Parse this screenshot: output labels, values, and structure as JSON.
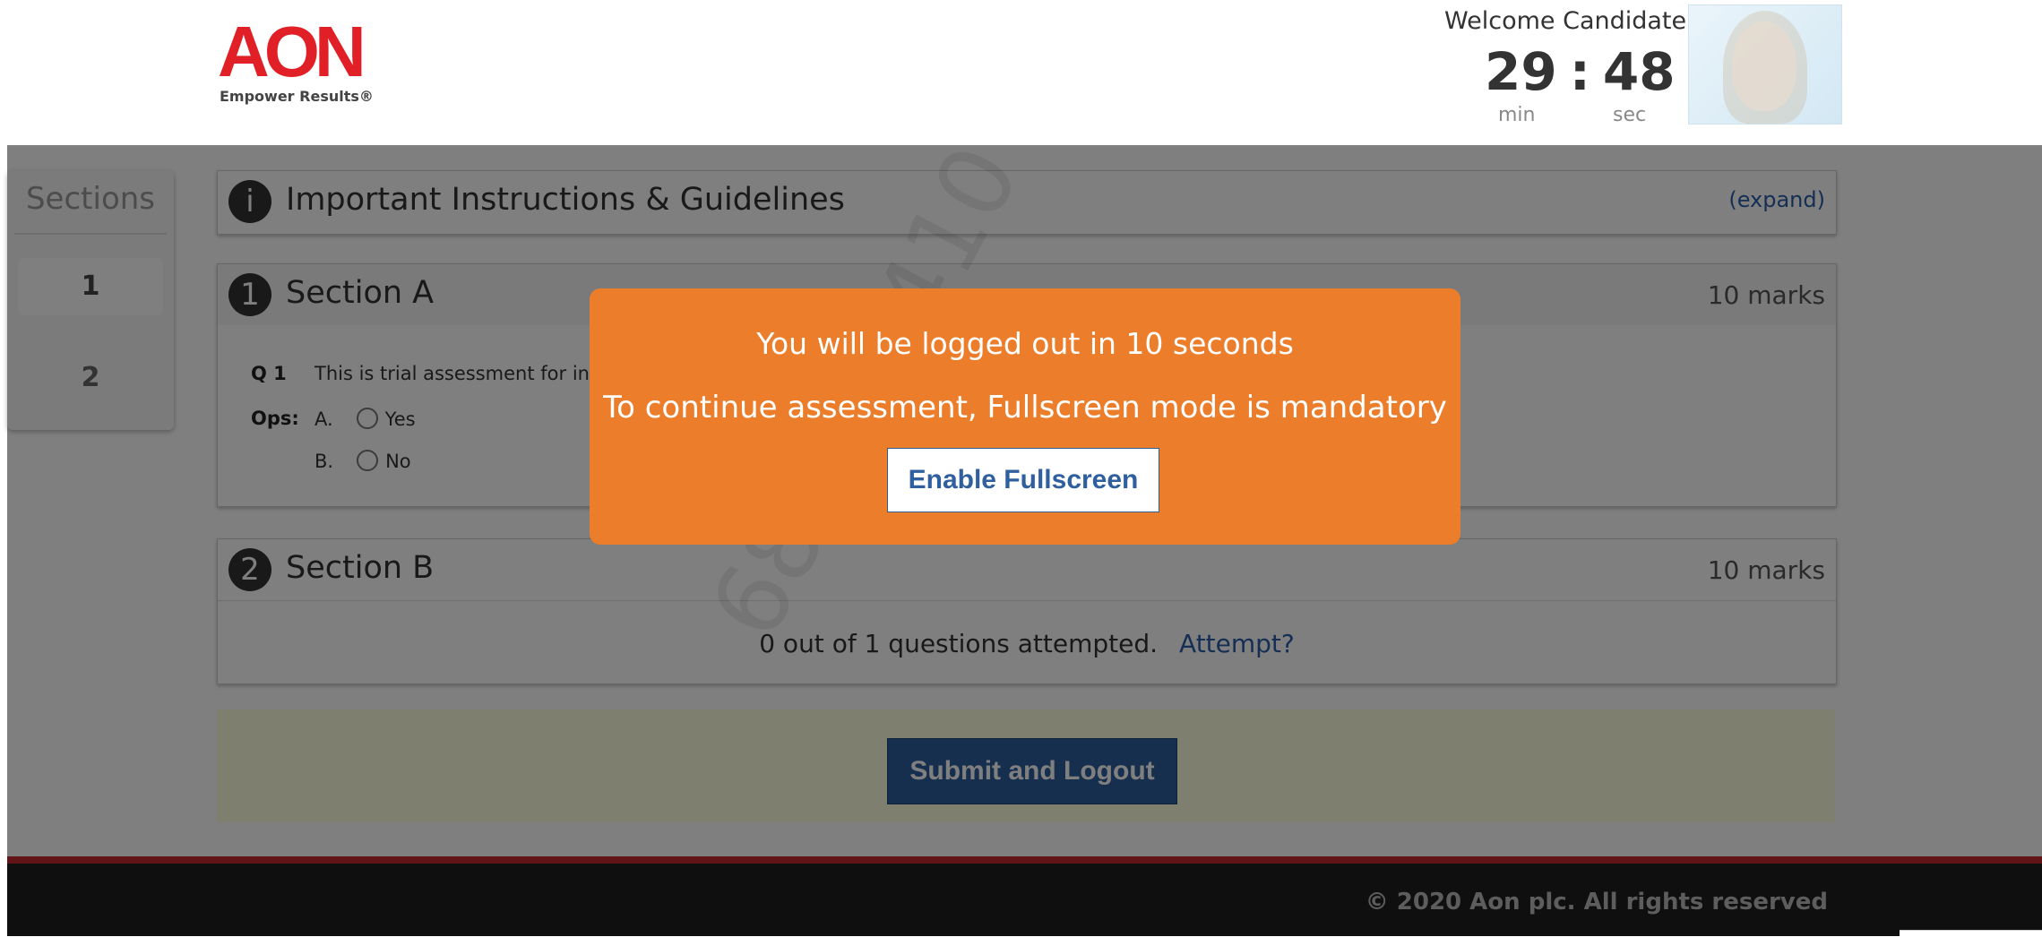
{
  "header": {
    "logo_text": "AON",
    "logo_tagline": "Empower Results®",
    "welcome": "Welcome Candidate",
    "timer": {
      "minutes": "29",
      "separator": ":",
      "seconds": "48",
      "min_label": "min",
      "sec_label": "sec"
    }
  },
  "sidebar": {
    "title": "Sections",
    "items": [
      {
        "label": "1"
      },
      {
        "label": "2"
      }
    ]
  },
  "instructions": {
    "icon_text": "i",
    "title": "Important Instructions & Guidelines",
    "expand_label": "(expand)"
  },
  "section_a": {
    "number": "1",
    "title": "Section A",
    "marks": "10 marks",
    "question_label": "Q 1",
    "question_text": "This is trial assessment for int",
    "ops_label": "Ops:",
    "options": [
      {
        "letter": "A.",
        "text": "Yes"
      },
      {
        "letter": "B.",
        "text": "No"
      }
    ]
  },
  "section_b": {
    "number": "2",
    "title": "Section B",
    "marks": "10 marks",
    "attempted_text": "0 out of 1 questions attempted.",
    "attempt_link": "Attempt?"
  },
  "submit_label": "Submit and Logout",
  "watermark": "6851-9410",
  "footer": {
    "copyright": "© 2020 Aon plc. All rights reserved"
  },
  "modal": {
    "line1": "You will be logged out in 10 seconds",
    "line2": "To continue assessment, Fullscreen mode is mandatory",
    "button_label": "Enable Fullscreen"
  },
  "colors": {
    "brand_red": "#e01f26",
    "modal_orange": "#ec7e2b",
    "button_blue": "#2f5f9e"
  }
}
